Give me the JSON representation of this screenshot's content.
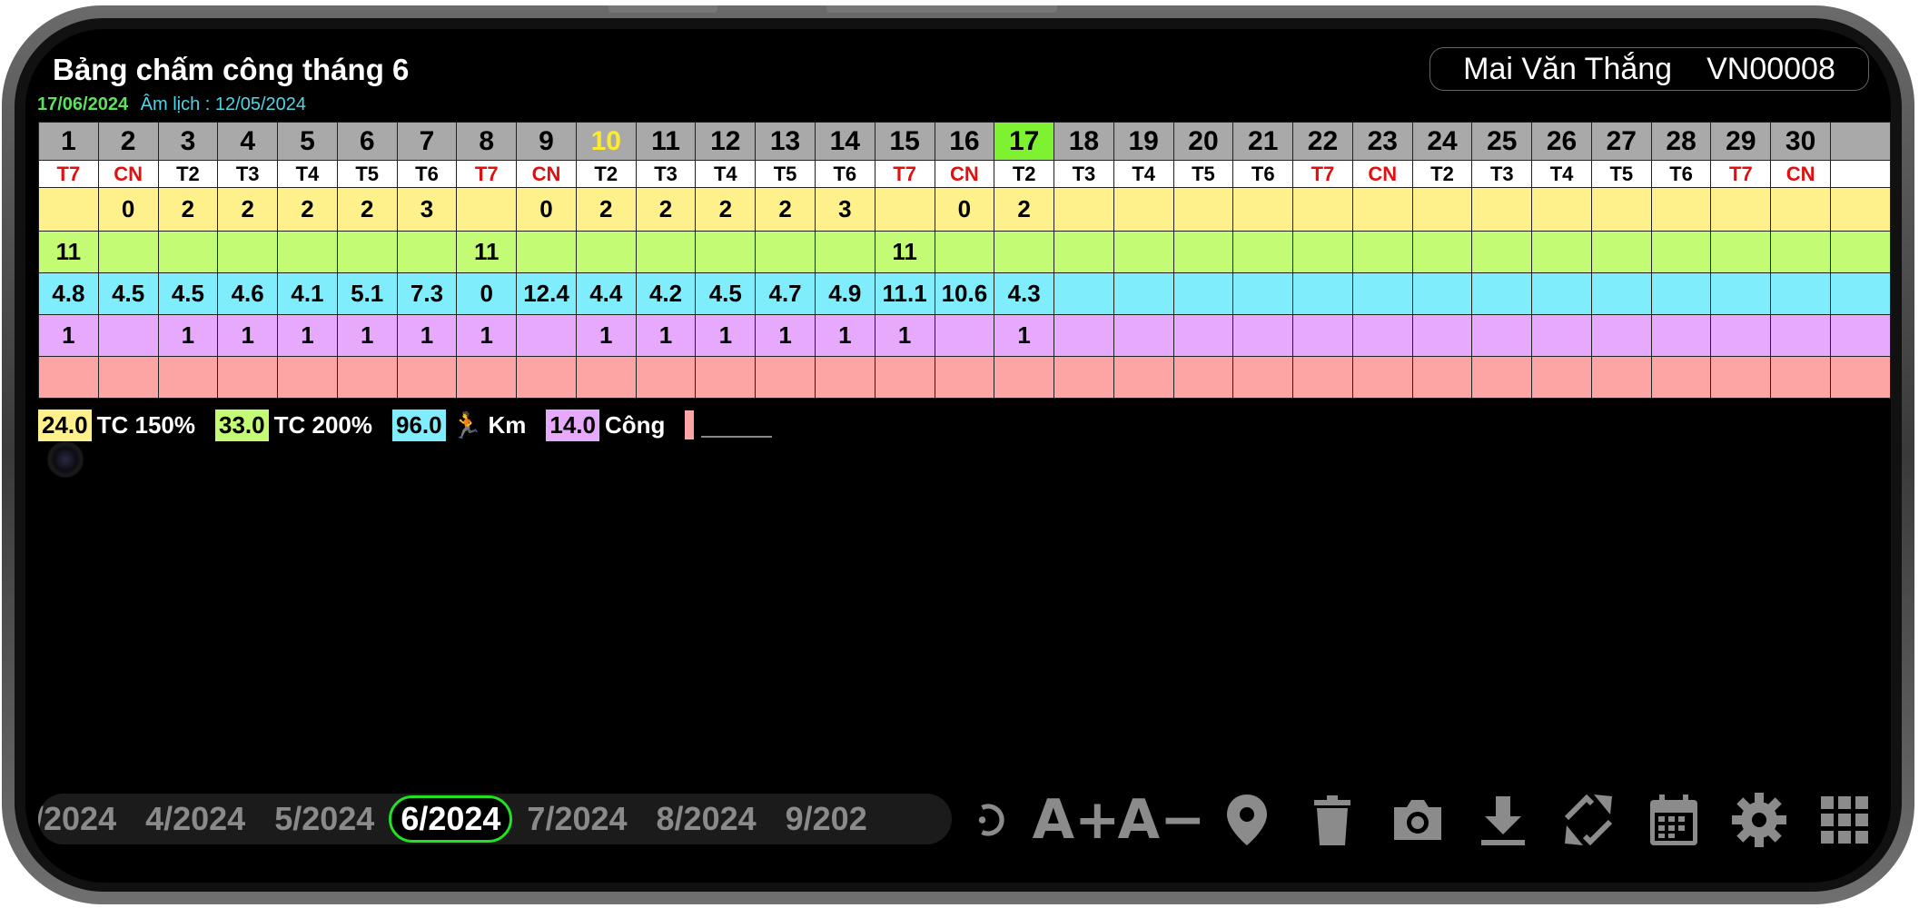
{
  "header": {
    "title": "Bảng chấm công tháng 6",
    "date_solar": "17/06/2024",
    "date_lunar": "Âm lịch : 12/05/2024",
    "user_name": "Mai Văn Thắng",
    "user_code": "VN00008"
  },
  "grid": {
    "days": [
      "1",
      "2",
      "3",
      "4",
      "5",
      "6",
      "7",
      "8",
      "9",
      "10",
      "11",
      "12",
      "13",
      "14",
      "15",
      "16",
      "17",
      "18",
      "19",
      "20",
      "21",
      "22",
      "23",
      "24",
      "25",
      "26",
      "27",
      "28",
      "29",
      "30",
      ""
    ],
    "weekdays": [
      "T7",
      "CN",
      "T2",
      "T3",
      "T4",
      "T5",
      "T6",
      "T7",
      "CN",
      "T2",
      "T3",
      "T4",
      "T5",
      "T6",
      "T7",
      "CN",
      "T2",
      "T3",
      "T4",
      "T5",
      "T6",
      "T7",
      "CN",
      "T2",
      "T3",
      "T4",
      "T5",
      "T6",
      "T7",
      "CN",
      ""
    ],
    "tc150": [
      "",
      "0",
      "2",
      "2",
      "2",
      "2",
      "3",
      "",
      "0",
      "2",
      "2",
      "2",
      "2",
      "3",
      "",
      "0",
      "2",
      "",
      "",
      "",
      "",
      "",
      "",
      "",
      "",
      "",
      "",
      "",
      "",
      "",
      ""
    ],
    "tc200": [
      "11",
      "",
      "",
      "",
      "",
      "",
      "",
      "11",
      "",
      "",
      "",
      "",
      "",
      "",
      "11",
      "",
      "",
      "",
      "",
      "",
      "",
      "",
      "",
      "",
      "",
      "",
      "",
      "",
      "",
      "",
      ""
    ],
    "km": [
      "4.8",
      "4.5",
      "4.5",
      "4.6",
      "4.1",
      "5.1",
      "7.3",
      "0",
      "12.4",
      "4.4",
      "4.2",
      "4.5",
      "4.7",
      "4.9",
      "11.1",
      "10.6",
      "4.3",
      "",
      "",
      "",
      "",
      "",
      "",
      "",
      "",
      "",
      "",
      "",
      "",
      "",
      ""
    ],
    "cong": [
      "1",
      "",
      "1",
      "1",
      "1",
      "1",
      "1",
      "1",
      "",
      "1",
      "1",
      "1",
      "1",
      "1",
      "1",
      "",
      "1",
      "",
      "",
      "",
      "",
      "",
      "",
      "",
      "",
      "",
      "",
      "",
      "",
      "",
      ""
    ]
  },
  "summary": {
    "tc150_value": "24.0",
    "tc150_label": "TC 150%",
    "tc200_value": "33.0",
    "tc200_label": "TC 200%",
    "km_value": "96.0",
    "km_icon": "🏃",
    "km_label": "Km",
    "cong_value": "14.0",
    "cong_label": "Công"
  },
  "months": [
    "/2024",
    "4/2024",
    "5/2024",
    "6/2024",
    "7/2024",
    "8/2024",
    "9/202"
  ],
  "toolbar": {
    "font_increase": "A+",
    "font_decrease": "A−",
    "icons": [
      "refresh-icon",
      "font-increase-icon",
      "font-decrease-icon",
      "location-pin-icon",
      "trash-icon",
      "camera-icon",
      "download-icon",
      "sync-icon",
      "calendar-icon",
      "settings-icon",
      "apps-grid-icon"
    ]
  },
  "colors": {
    "today": "#7ef230",
    "weekend_text": "#e01010",
    "tc150": "#fef08a",
    "tc200": "#c4fb74",
    "km": "#7fedfb",
    "cong": "#e6a9fc",
    "extra": "#fda4a5",
    "active_month_border": "#22e022"
  }
}
